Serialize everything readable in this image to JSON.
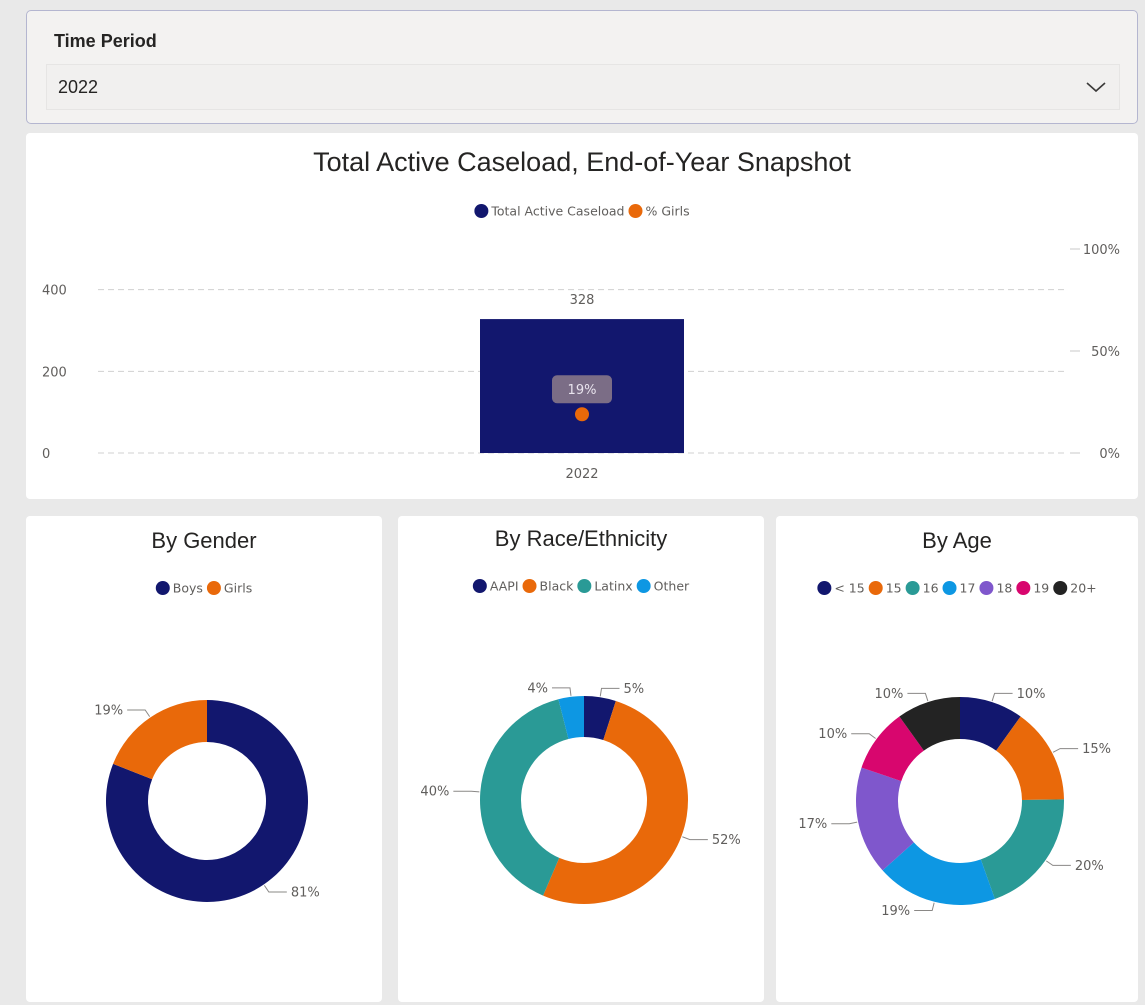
{
  "slicer": {
    "title": "Time Period",
    "selected": "2022",
    "icon": "chevron-down-icon"
  },
  "colors": {
    "navy": "#12176e",
    "orange": "#e9690a",
    "teal": "#2a9a96",
    "blue": "#0d97e3",
    "purple": "#7f57cc",
    "magenta": "#d8066e",
    "black": "#232323",
    "label_box": "#7b6d86"
  },
  "chart_data": [
    {
      "id": "caseload",
      "type": "bar",
      "title": "Total Active Caseload, End-of-Year Snapshot",
      "categories": [
        "2022"
      ],
      "series": [
        {
          "name": "Total Active Caseload",
          "values": [
            328
          ],
          "color": "#12176e",
          "data_labels": [
            "328"
          ]
        },
        {
          "name": "% Girls",
          "values": [
            0.19
          ],
          "color": "#e9690a",
          "mark": "point",
          "axis": "secondary",
          "data_labels": [
            "19%"
          ]
        }
      ],
      "y_ticks": [
        "0",
        "200",
        "400"
      ],
      "ylim": [
        0,
        500
      ],
      "y2_ticks": [
        "0%",
        "50%",
        "100%"
      ],
      "y2lim": [
        0,
        1
      ],
      "legend": "top-center",
      "grid": true
    },
    {
      "id": "gender",
      "type": "pie",
      "title": "By Gender",
      "labels": [
        "Boys",
        "Girls"
      ],
      "values": [
        81,
        19
      ],
      "data_labels": [
        "81%",
        "19%"
      ],
      "colors": [
        "#12176e",
        "#e9690a"
      ],
      "donut": true,
      "legend": "top-center"
    },
    {
      "id": "race",
      "type": "pie",
      "title": "By Race/Ethnicity",
      "labels": [
        "AAPI",
        "Black",
        "Latinx",
        "Other"
      ],
      "values": [
        5,
        52,
        40,
        4
      ],
      "data_labels": [
        "5%",
        "52%",
        "40%",
        "4%"
      ],
      "colors": [
        "#12176e",
        "#e9690a",
        "#2a9a96",
        "#0d97e3"
      ],
      "donut": true,
      "legend": "top-center"
    },
    {
      "id": "age",
      "type": "pie",
      "title": "By Age",
      "labels": [
        "< 15",
        "15",
        "16",
        "17",
        "18",
        "19",
        "20+"
      ],
      "values": [
        10,
        15,
        20,
        19,
        17,
        10,
        10
      ],
      "data_labels": [
        "10%",
        "15%",
        "20%",
        "19%",
        "17%",
        "10%",
        "10%"
      ],
      "colors": [
        "#12176e",
        "#e9690a",
        "#2a9a96",
        "#0d97e3",
        "#7f57cc",
        "#d8066e",
        "#232323"
      ],
      "donut": true,
      "legend": "top-center"
    }
  ]
}
